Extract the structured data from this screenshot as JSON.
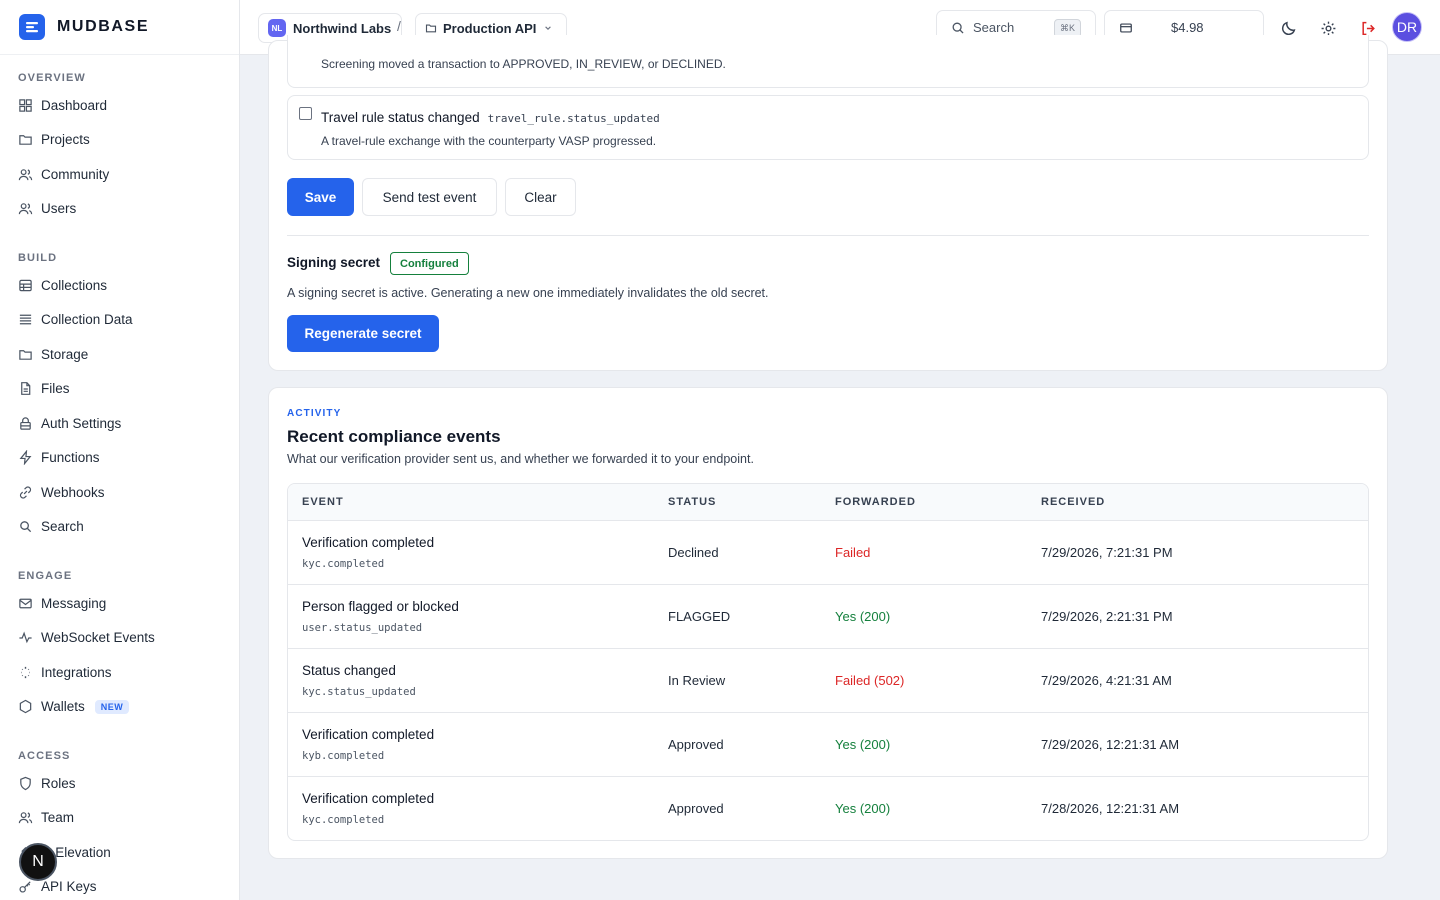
{
  "app": {
    "name": "MUDBASE"
  },
  "sidebar": {
    "groups": [
      {
        "heading": "OVERVIEW",
        "items": [
          {
            "label": "Dashboard",
            "icon": "dashboard-icon"
          },
          {
            "label": "Projects",
            "icon": "folder-icon"
          },
          {
            "label": "Community",
            "icon": "users-icon"
          },
          {
            "label": "Users",
            "icon": "user-icon"
          }
        ]
      },
      {
        "heading": "BUILD",
        "items": [
          {
            "label": "Collections",
            "icon": "database-icon"
          },
          {
            "label": "Collection Data",
            "icon": "list-icon"
          },
          {
            "label": "Storage",
            "icon": "folder-icon"
          },
          {
            "label": "Files",
            "icon": "file-icon"
          },
          {
            "label": "Auth Settings",
            "icon": "lock-icon"
          },
          {
            "label": "Functions",
            "icon": "bolt-icon"
          },
          {
            "label": "Webhooks",
            "icon": "link-icon"
          },
          {
            "label": "Search",
            "icon": "search-icon"
          }
        ]
      },
      {
        "heading": "ENGAGE",
        "items": [
          {
            "label": "Messaging",
            "icon": "mail-icon"
          },
          {
            "label": "WebSocket Events",
            "icon": "pulse-icon"
          },
          {
            "label": "Integrations",
            "icon": "plug-icon"
          },
          {
            "label": "Wallets",
            "icon": "hexagon-icon",
            "badge": "NEW"
          }
        ]
      },
      {
        "heading": "ACCESS",
        "items": [
          {
            "label": "Roles",
            "icon": "shield-icon"
          },
          {
            "label": "Team",
            "icon": "team-icon"
          },
          {
            "label": "le Elevation",
            "icon": "elevation-icon"
          },
          {
            "label": "API Keys",
            "icon": "key-icon"
          }
        ]
      }
    ]
  },
  "topbar": {
    "org_initials": "NL",
    "org_name": "Northwind Labs",
    "separator": "/",
    "project_name": "Production API",
    "search_label": "Search",
    "search_shortcut": "⌘K",
    "balance": "$4.98",
    "avatar_initials": "DR"
  },
  "webhook_form": {
    "partial_event_desc": "Screening moved a transaction to APPROVED, IN_REVIEW, or DECLINED.",
    "event": {
      "title": "Travel rule status changed",
      "code": "travel_rule.status_updated",
      "desc": "A travel-rule exchange with the counterparty VASP progressed.",
      "checked": false
    },
    "save_label": "Save",
    "test_label": "Send test event",
    "clear_label": "Clear",
    "secret_title": "Signing secret",
    "secret_badge": "Configured",
    "secret_desc": "A signing secret is active. Generating a new one immediately invalidates the old secret.",
    "regenerate_label": "Regenerate secret"
  },
  "activity": {
    "label": "ACTIVITY",
    "title": "Recent compliance events",
    "desc": "What our verification provider sent us, and whether we forwarded it to your endpoint.",
    "columns": [
      "EVENT",
      "STATUS",
      "FORWARDED",
      "RECEIVED"
    ],
    "rows": [
      {
        "name": "Verification completed",
        "code": "kyc.completed",
        "status": "Declined",
        "forwarded": "Failed",
        "forwarded_ok": false,
        "received": "7/29/2026, 7:21:31 PM"
      },
      {
        "name": "Person flagged or blocked",
        "code": "user.status_updated",
        "status": "FLAGGED",
        "forwarded": "Yes (200)",
        "forwarded_ok": true,
        "received": "7/29/2026, 2:21:31 PM"
      },
      {
        "name": "Status changed",
        "code": "kyc.status_updated",
        "status": "In Review",
        "forwarded": "Failed (502)",
        "forwarded_ok": false,
        "received": "7/29/2026, 4:21:31 AM"
      },
      {
        "name": "Verification completed",
        "code": "kyb.completed",
        "status": "Approved",
        "forwarded": "Yes (200)",
        "forwarded_ok": true,
        "received": "7/29/2026, 12:21:31 AM"
      },
      {
        "name": "Verification completed",
        "code": "kyc.completed",
        "status": "Approved",
        "forwarded": "Yes (200)",
        "forwarded_ok": true,
        "received": "7/28/2026, 12:21:31 AM"
      }
    ]
  },
  "floating_button": "N",
  "colors": {
    "accent": "#2563eb",
    "success": "#15803d",
    "danger": "#dc2626"
  }
}
